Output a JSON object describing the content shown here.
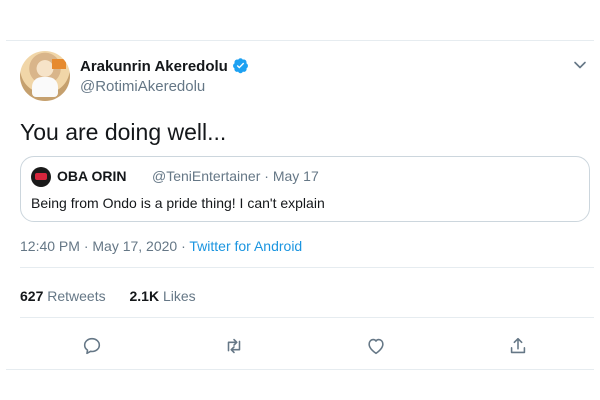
{
  "tweet": {
    "author_name": "Arakunrin Akeredolu",
    "author_handle": "@RotimiAkeredolu",
    "text": "You are doing well...",
    "timestamp": "12:40 PM · May 17, 2020 · ",
    "source": "Twitter for Android"
  },
  "quoted": {
    "author_name": "OBA ORIN",
    "author_handle": "@TeniEntertainer · May 17",
    "text": "Being from Ondo is a pride thing! I can't explain"
  },
  "stats": {
    "retweets_count": "627",
    "retweets_label": "Retweets",
    "likes_count": "2.1K",
    "likes_label": "Likes"
  },
  "icons": {
    "verified": "verified-badge-icon",
    "more": "chevron-down-icon",
    "reply": "reply-icon",
    "retweet": "retweet-icon",
    "like": "heart-icon",
    "share": "share-icon"
  },
  "colors": {
    "verified": "#1da1f2",
    "link": "#1b95e0",
    "secondary_text": "#657786",
    "border": "#e6ecf0"
  }
}
